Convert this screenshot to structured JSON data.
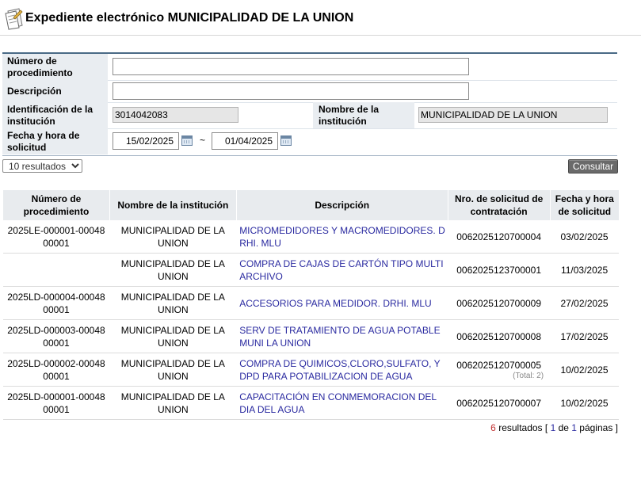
{
  "page": {
    "title": "Expediente electrónico MUNICIPALIDAD DE LA UNION"
  },
  "form": {
    "proc_label": "Número de procedimiento",
    "proc_value": "",
    "desc_label": "Descripción",
    "desc_value": "",
    "inst_id_label": "Identificación de la institución",
    "inst_id_value": "3014042083",
    "inst_name_label": "Nombre de la institución",
    "inst_name_value": "MUNICIPALIDAD DE LA UNION",
    "date_label": "Fecha y hora de solicitud",
    "date_from": "15/02/2025",
    "date_sep": "~",
    "date_to": "01/04/2025"
  },
  "toolbar": {
    "page_size": "10 resultados",
    "consult_label": "Consultar"
  },
  "table": {
    "headers": [
      "Número de procedimiento",
      "Nombre de la institución",
      "Descripción",
      "Nro. de solicitud de contratación",
      "Fecha y hora de solicitud"
    ],
    "rows": [
      {
        "proc": "2025LE-000001-0004800001",
        "inst": "MUNICIPALIDAD DE LA UNION",
        "desc": "MICROMEDIDORES Y MACROMEDIDORES. DRHI. MLU",
        "nro": "0062025120700004",
        "total": "",
        "fecha": "03/02/2025"
      },
      {
        "proc": "",
        "inst": "MUNICIPALIDAD DE LA UNION",
        "desc": "COMPRA DE CAJAS DE CARTÓN TIPO MULTIARCHIVO",
        "nro": "0062025123700001",
        "total": "",
        "fecha": "11/03/2025"
      },
      {
        "proc": "2025LD-000004-0004800001",
        "inst": "MUNICIPALIDAD DE LA UNION",
        "desc": "ACCESORIOS PARA MEDIDOR. DRHI. MLU",
        "nro": "0062025120700009",
        "total": "",
        "fecha": "27/02/2025"
      },
      {
        "proc": "2025LD-000003-0004800001",
        "inst": "MUNICIPALIDAD DE LA UNION",
        "desc": "SERV DE TRATAMIENTO DE AGUA POTABLE MUNI LA UNION",
        "nro": "0062025120700008",
        "total": "",
        "fecha": "17/02/2025"
      },
      {
        "proc": "2025LD-000002-0004800001",
        "inst": "MUNICIPALIDAD DE LA UNION",
        "desc": "COMPRA DE QUIMICOS,CLORO,SULFATO, Y DPD PARA POTABILIZACION DE AGUA",
        "nro": "0062025120700005",
        "total": "(Total: 2)",
        "fecha": "10/02/2025"
      },
      {
        "proc": "2025LD-000001-0004800001",
        "inst": "MUNICIPALIDAD DE LA UNION",
        "desc": "CAPACITACIÓN EN CONMEMORACION DEL DIA DEL AGUA",
        "nro": "0062025120700007",
        "total": "",
        "fecha": "10/02/2025"
      }
    ]
  },
  "pager": {
    "count": "6",
    "results_word": " resultados [ ",
    "page": "1",
    "of_word": " de ",
    "pages": "1",
    "pages_word": " páginas ]"
  }
}
